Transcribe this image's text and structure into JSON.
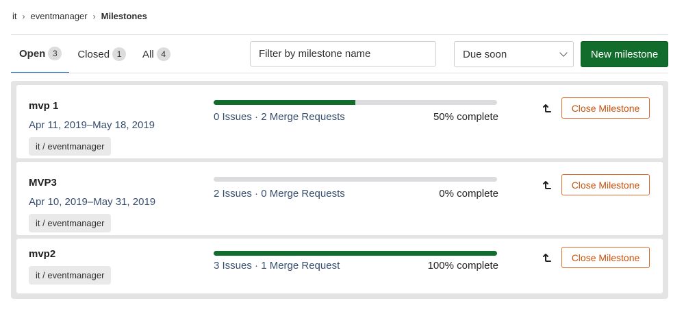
{
  "breadcrumb": {
    "items": [
      "it",
      "eventmanager"
    ],
    "current": "Milestones"
  },
  "tabs": [
    {
      "label": "Open",
      "count": "3",
      "active": true
    },
    {
      "label": "Closed",
      "count": "1",
      "active": false
    },
    {
      "label": "All",
      "count": "4",
      "active": false
    }
  ],
  "filter": {
    "placeholder": "Filter by milestone name"
  },
  "sort": {
    "selected": "Due soon"
  },
  "new_button": {
    "label": "New milestone"
  },
  "colors": {
    "accent": "#126c2c",
    "tab_active": "#1f75cb",
    "close_border": "#dd6a2c"
  },
  "milestones": [
    {
      "title": "mvp 1",
      "dates": "Apr 11, 2019–May 18, 2019",
      "project": "it / eventmanager",
      "stats": "0 Issues · 2 Merge Requests",
      "percent_label": "50% complete",
      "progress": 50,
      "promote_icon": "promote-icon",
      "close_label": "Close Milestone"
    },
    {
      "title": "MVP3",
      "dates": "Apr 10, 2019–May 31, 2019",
      "project": "it / eventmanager",
      "stats": "2 Issues · 0 Merge Requests",
      "percent_label": "0% complete",
      "progress": 0,
      "promote_icon": "promote-icon",
      "close_label": "Close Milestone"
    },
    {
      "title": "mvp2",
      "dates": "",
      "project": "it / eventmanager",
      "stats": "3 Issues · 1 Merge Request",
      "percent_label": "100% complete",
      "progress": 100,
      "promote_icon": "promote-icon",
      "close_label": "Close Milestone"
    }
  ]
}
